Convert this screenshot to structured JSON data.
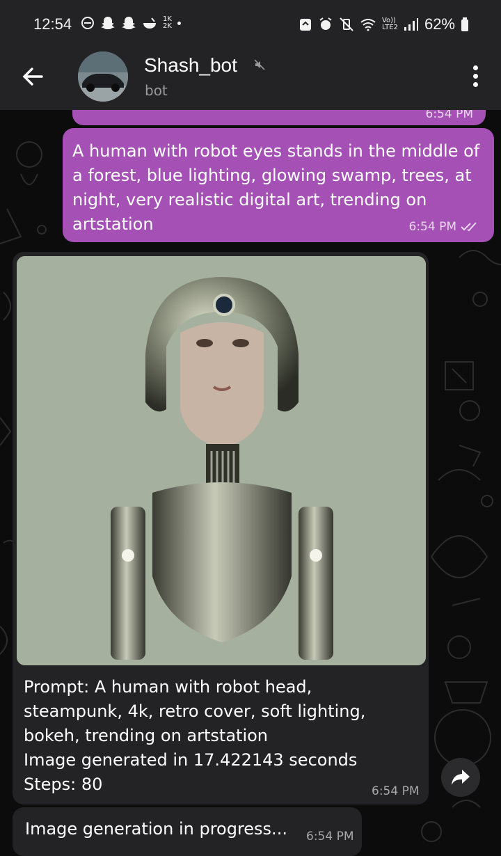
{
  "status_bar": {
    "time": "12:54",
    "small_top": "1K",
    "small_bottom": "2K",
    "network_top": "Vo))",
    "network_bottom": "LTE2",
    "battery": "62%"
  },
  "header": {
    "title": "Shash_bot",
    "subtitle": "bot"
  },
  "messages": {
    "prev_time": "6:54 PM",
    "user_prompt": {
      "text": "A human with robot eyes stands in the middle of a forest, blue lighting, glowing swamp, trees, at night, very realistic digital art, trending on artstation",
      "time": "6:54 PM"
    },
    "bot_image": {
      "caption_lines": [
        "Prompt: A human with robot head,",
        "steampunk, 4k, retro cover, soft lighting,",
        "bokeh, trending on artstation",
        "Image generated in 17.422143 seconds",
        "Steps: 80"
      ],
      "time": "6:54 PM"
    },
    "bot_status": {
      "text": "Image generation in progress...",
      "time": "6:54 PM"
    }
  },
  "colors": {
    "outgoing_bubble": "#a450b5",
    "incoming_bubble": "#232325",
    "header_bg": "#232325",
    "chat_bg": "#0c0c0c"
  },
  "icons": [
    "back-arrow-icon",
    "mute-icon",
    "more-vert-icon",
    "forward-icon",
    "double-check-icon"
  ]
}
